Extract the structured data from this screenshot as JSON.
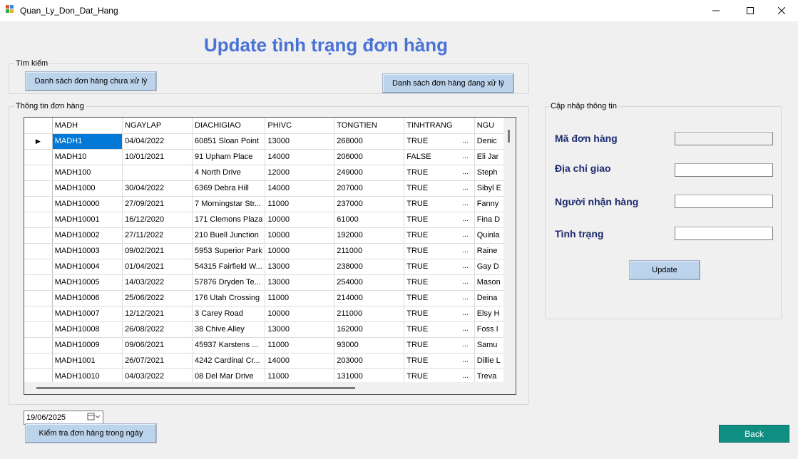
{
  "window": {
    "title": "Quan_Ly_Don_Dat_Hang",
    "minimize_icon": "minimize-icon",
    "maximize_icon": "maximize-icon",
    "close_icon": "close-icon"
  },
  "heading": "Update tình trạng đơn hàng",
  "search_group": {
    "label": "Tìm kiếm",
    "btn_pending": "Danh sách đơn hàng chưa xử lý",
    "btn_processing": "Danh sách đơn hàng đang xử lý"
  },
  "orders_group": {
    "label": "Thông tin đơn hàng",
    "columns": [
      "MADH",
      "NGAYLAP",
      "DIACHIGIAO",
      "PHIVC",
      "TONGTIEN",
      "TINHTRANG",
      "NGU"
    ],
    "rows": [
      [
        "MADH1",
        "04/04/2022",
        "60851 Sloan Point",
        "13000",
        "268000",
        "TRUE",
        "Denic"
      ],
      [
        "MADH10",
        "10/01/2021",
        "91 Upham Place",
        "14000",
        "206000",
        "FALSE",
        "Eli Jar"
      ],
      [
        "MADH100",
        "",
        "4 North Drive",
        "12000",
        "249000",
        "TRUE",
        "Steph"
      ],
      [
        "MADH1000",
        "30/04/2022",
        "6369 Debra Hill",
        "14000",
        "207000",
        "TRUE",
        "Sibyl E"
      ],
      [
        "MADH10000",
        "27/09/2021",
        "7 Morningstar Str...",
        "11000",
        "237000",
        "TRUE",
        "Fanny"
      ],
      [
        "MADH10001",
        "16/12/2020",
        "171 Clemons Plaza",
        "10000",
        "61000",
        "TRUE",
        "Fina D"
      ],
      [
        "MADH10002",
        "27/11/2022",
        "210 Buell Junction",
        "10000",
        "192000",
        "TRUE",
        "Quinla"
      ],
      [
        "MADH10003",
        "09/02/2021",
        "5953 Superior Park",
        "10000",
        "211000",
        "TRUE",
        "Raine"
      ],
      [
        "MADH10004",
        "01/04/2021",
        "54315 Fairfield W...",
        "13000",
        "238000",
        "TRUE",
        "Gay D"
      ],
      [
        "MADH10005",
        "14/03/2022",
        "57876 Dryden Te...",
        "13000",
        "254000",
        "TRUE",
        "Mason"
      ],
      [
        "MADH10006",
        "25/06/2022",
        "176 Utah Crossing",
        "11000",
        "214000",
        "TRUE",
        "Deina"
      ],
      [
        "MADH10007",
        "12/12/2021",
        "3 Carey Road",
        "10000",
        "211000",
        "TRUE",
        "Elsy H"
      ],
      [
        "MADH10008",
        "26/08/2022",
        "38 Chive Alley",
        "13000",
        "162000",
        "TRUE",
        "Foss I"
      ],
      [
        "MADH10009",
        "09/06/2021",
        "45937 Karstens ...",
        "11000",
        "93000",
        "TRUE",
        "Samu"
      ],
      [
        "MADH1001",
        "26/07/2021",
        "4242 Cardinal Cr...",
        "14000",
        "203000",
        "TRUE",
        "Dillie L"
      ],
      [
        "MADH10010",
        "04/03/2022",
        "08 Del Mar Drive",
        "11000",
        "131000",
        "TRUE",
        "Treva"
      ]
    ],
    "current_row_marker": "▶"
  },
  "update_group": {
    "label": "Cập nhập thông tin",
    "order_id_label": "Mã đơn hàng",
    "address_label": "Địa chỉ giao",
    "receiver_label": "Người nhận hàng",
    "status_label": "Tình trạng",
    "order_id_value": "",
    "address_value": "",
    "receiver_value": "",
    "status_value": "",
    "update_button": "Update"
  },
  "date_picker": {
    "value": "19/06/2025",
    "icon": "calendar-icon"
  },
  "check_today_button": "Kiểm tra đơn hàng trong ngày",
  "back_button": "Back",
  "colors": {
    "heading": "#4a72d6",
    "button_bg": "#bcd3ec",
    "back_bg": "#0f8f82",
    "label_text": "#1c2a6e",
    "selection": "#0078d7"
  }
}
